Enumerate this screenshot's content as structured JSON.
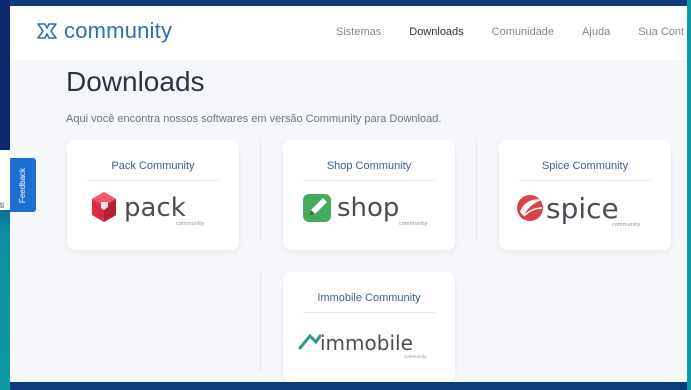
{
  "brand": {
    "name": "community"
  },
  "nav": {
    "items": [
      "Sistemas",
      "Downloads",
      "Comunidade",
      "Ajuda",
      "Sua Cont"
    ],
    "active": "Downloads"
  },
  "page": {
    "title": "Downloads",
    "subtitle": "Aqui você encontra nossos softwares em versão Community para Download."
  },
  "products": [
    {
      "title": "Pack Community",
      "logo_word": "pack",
      "logo_sub": "community",
      "color": "#e0314a"
    },
    {
      "title": "Shop Community",
      "logo_word": "shop",
      "logo_sub": "community",
      "color": "#43a85a"
    },
    {
      "title": "Spice Community",
      "logo_word": "spice",
      "logo_sub": "community",
      "color": "#d9474f"
    },
    {
      "title": "Immobile Community",
      "logo_word": "immobile",
      "logo_sub": "community",
      "color": "#2e9a83"
    }
  ],
  "feedback": {
    "label": "Feedback"
  },
  "side_snippet": "ti"
}
